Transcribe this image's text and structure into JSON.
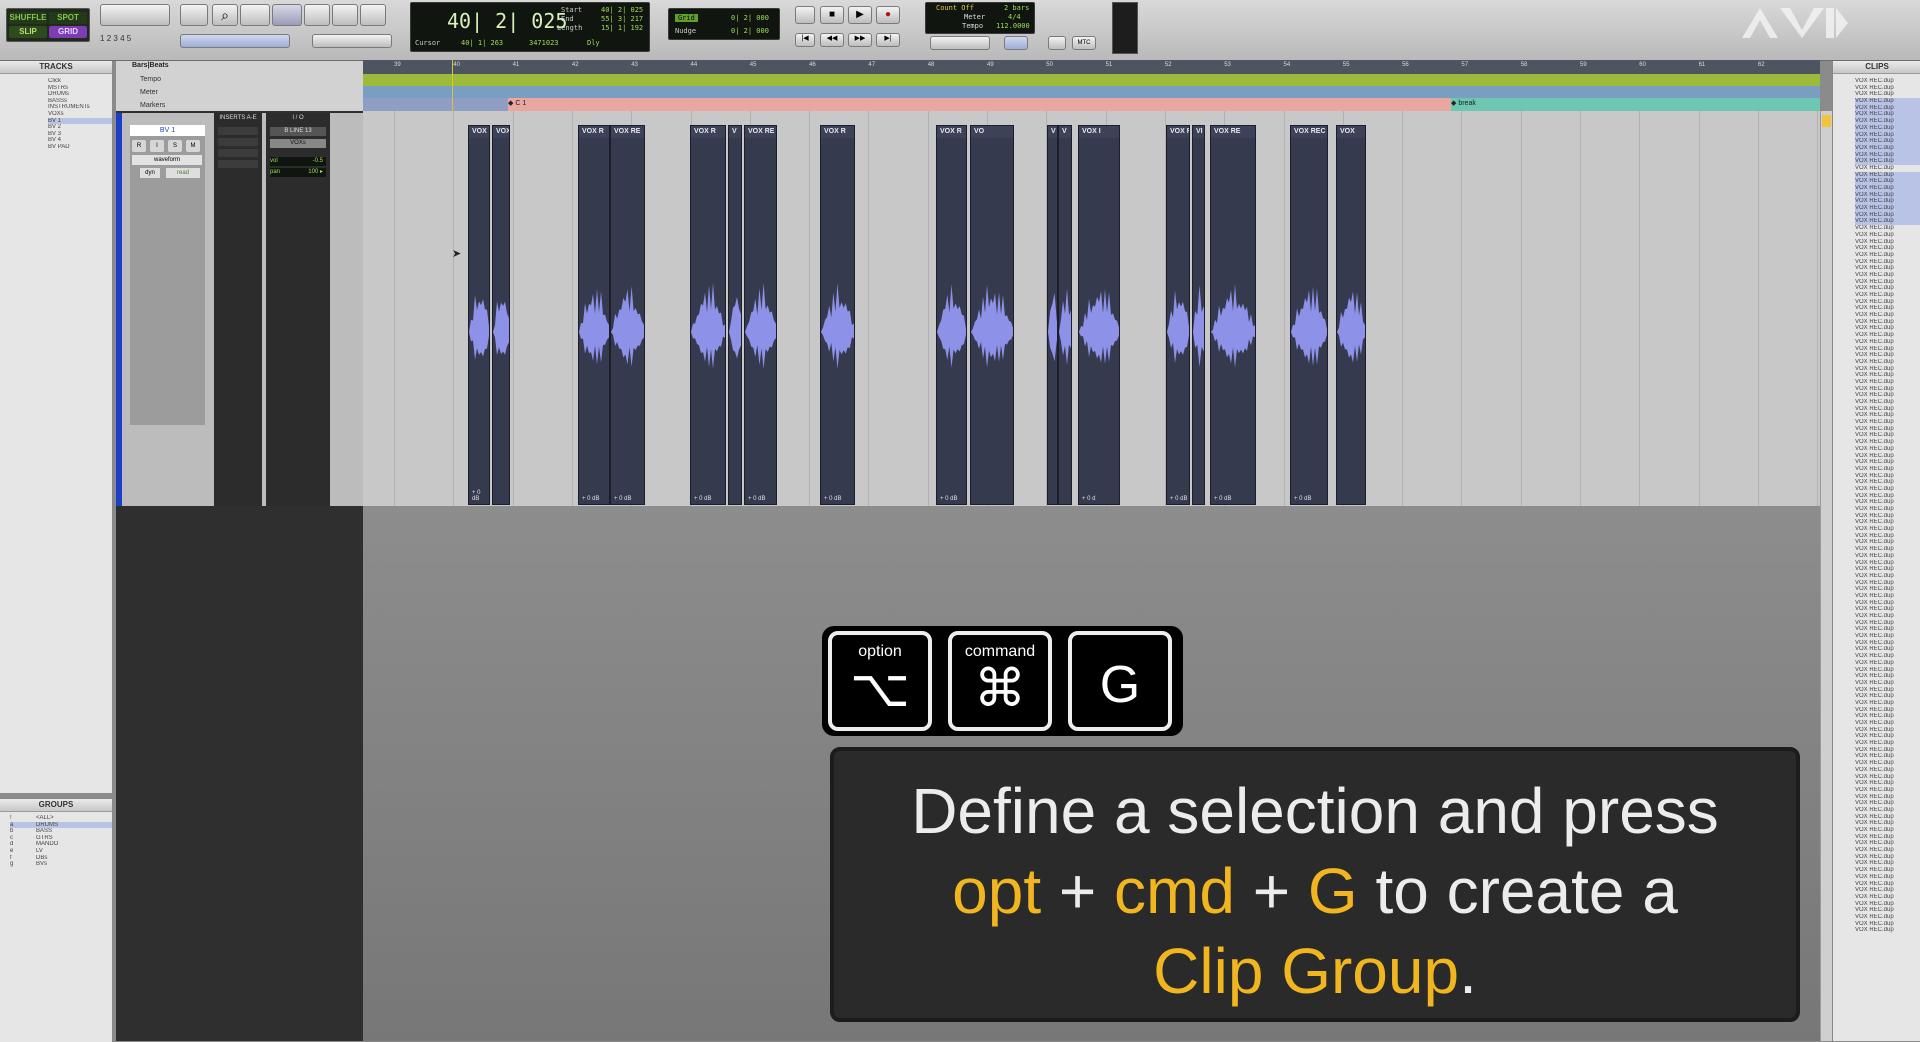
{
  "toolbar": {
    "modes": [
      "SHUFFLE",
      "SPOT",
      "SLIP",
      "GRID"
    ],
    "counter_main": "40| 2| 025",
    "start_label": "Start",
    "start_value": "40| 2| 025",
    "end_label": "End",
    "end_value": "55| 3| 217",
    "length_label": "Length",
    "length_value": "15| 1| 192",
    "cursor_label": "Cursor",
    "cursor_value": "40| 1| 263",
    "sample_value": "3471023",
    "dly_label": "Dly",
    "grid_label": "Grid",
    "grid_value": "0| 2| 000",
    "nudge_label": "Nudge",
    "nudge_value": "0| 2| 000",
    "countoff_label": "Count Off",
    "countoff_value": "2 bars",
    "meter_label": "Meter",
    "meter_value": "4/4",
    "tempo_label": "Tempo",
    "tempo_value": "112.0000",
    "mtc_label": "MTC",
    "number_keys": [
      "1",
      "2",
      "3",
      "4",
      "5"
    ]
  },
  "tracks_panel": {
    "header": "TRACKS",
    "items": [
      "Click",
      "MSTRs",
      "DRUMs",
      "BASSs",
      "INSTRUMENTs",
      "VOXs",
      "BV 1",
      "BV 2",
      "BV 3",
      "BV 4",
      "BV PAD"
    ]
  },
  "groups_panel": {
    "header": "GROUPS",
    "items": [
      {
        "id": "!",
        "name": "<ALL>"
      },
      {
        "id": "a",
        "name": "DRUMS"
      },
      {
        "id": "b",
        "name": "BASS"
      },
      {
        "id": "c",
        "name": "GTRS"
      },
      {
        "id": "d",
        "name": "MANDO"
      },
      {
        "id": "e",
        "name": "LV"
      },
      {
        "id": "f",
        "name": "DBs"
      },
      {
        "id": "g",
        "name": "BVs"
      }
    ]
  },
  "clips_panel": {
    "header": "CLIPS",
    "item_label": "VOX REC.dup",
    "item_count": 128
  },
  "rulers": {
    "bars_label": "Bars|Beats",
    "tempo_label": "Tempo",
    "meter_label": "Meter",
    "markers_label": "Markers",
    "bar_numbers": [
      "39",
      "40",
      "41",
      "42",
      "43",
      "44",
      "45",
      "46",
      "47",
      "48",
      "49",
      "50",
      "51",
      "52",
      "53",
      "54",
      "55",
      "56",
      "57",
      "58",
      "59",
      "60",
      "61",
      "62"
    ],
    "marker_c1": "C 1",
    "marker_break": "break"
  },
  "track": {
    "name": "BV 1",
    "inserts_label": "INSERTS A-E",
    "io_label": "I / O",
    "input": "B LINE 13",
    "output": "VOXs",
    "view": "waveform",
    "buttons": [
      "R",
      "I",
      "S",
      "M"
    ],
    "dyn": "dyn",
    "read": "read",
    "vol_label": "vol",
    "vol_value": "-0.5",
    "pan_label": "pan",
    "pan_value": "100 ▸"
  },
  "clips": [
    {
      "label": "VOX R",
      "gain": "+ 0 dB"
    },
    {
      "label": "VOX",
      "gain": ""
    },
    {
      "label": "VOX R",
      "gain": "+ 0 dB"
    },
    {
      "label": "VOX RE",
      "gain": "+ 0 dB"
    },
    {
      "label": "VOX R",
      "gain": "+ 0 dB"
    },
    {
      "label": "V",
      "gain": ""
    },
    {
      "label": "VOX RE",
      "gain": "+ 0 dB"
    },
    {
      "label": "VOX R",
      "gain": "+ 0 dB"
    },
    {
      "label": "VOX R",
      "gain": "+ 0 dB"
    },
    {
      "label": "VO",
      "gain": ""
    },
    {
      "label": "V",
      "gain": ""
    },
    {
      "label": "V",
      "gain": ""
    },
    {
      "label": "VOX I",
      "gain": "+ 0 d"
    },
    {
      "label": "VOX F",
      "gain": "+ 0 dB"
    },
    {
      "label": "VI",
      "gain": ""
    },
    {
      "label": "VOX RE",
      "gain": "+ 0 dB"
    },
    {
      "label": "VOX REC",
      "gain": "+ 0 dB"
    },
    {
      "label": "VOX",
      "gain": ""
    }
  ],
  "overlay": {
    "key1_label": "option",
    "key1_glyph": "⌥",
    "key2_label": "command",
    "key2_glyph": "⌘",
    "key3_glyph": "G",
    "caption_line1": "Define a selection and press",
    "caption_opt": "opt",
    "caption_plus1": " + ",
    "caption_cmd": "cmd",
    "caption_plus2": " + ",
    "caption_g": "G",
    "caption_line2_tail": " to create a",
    "caption_clipgroup": "Clip Group",
    "caption_period": "."
  },
  "colors": {
    "waveform": "#8d92e8",
    "clip_bg": "#353a4f",
    "highlight": "#f0b51f",
    "track_accent": "#1d3fc8",
    "lcd_text": "#9fdc5a"
  }
}
